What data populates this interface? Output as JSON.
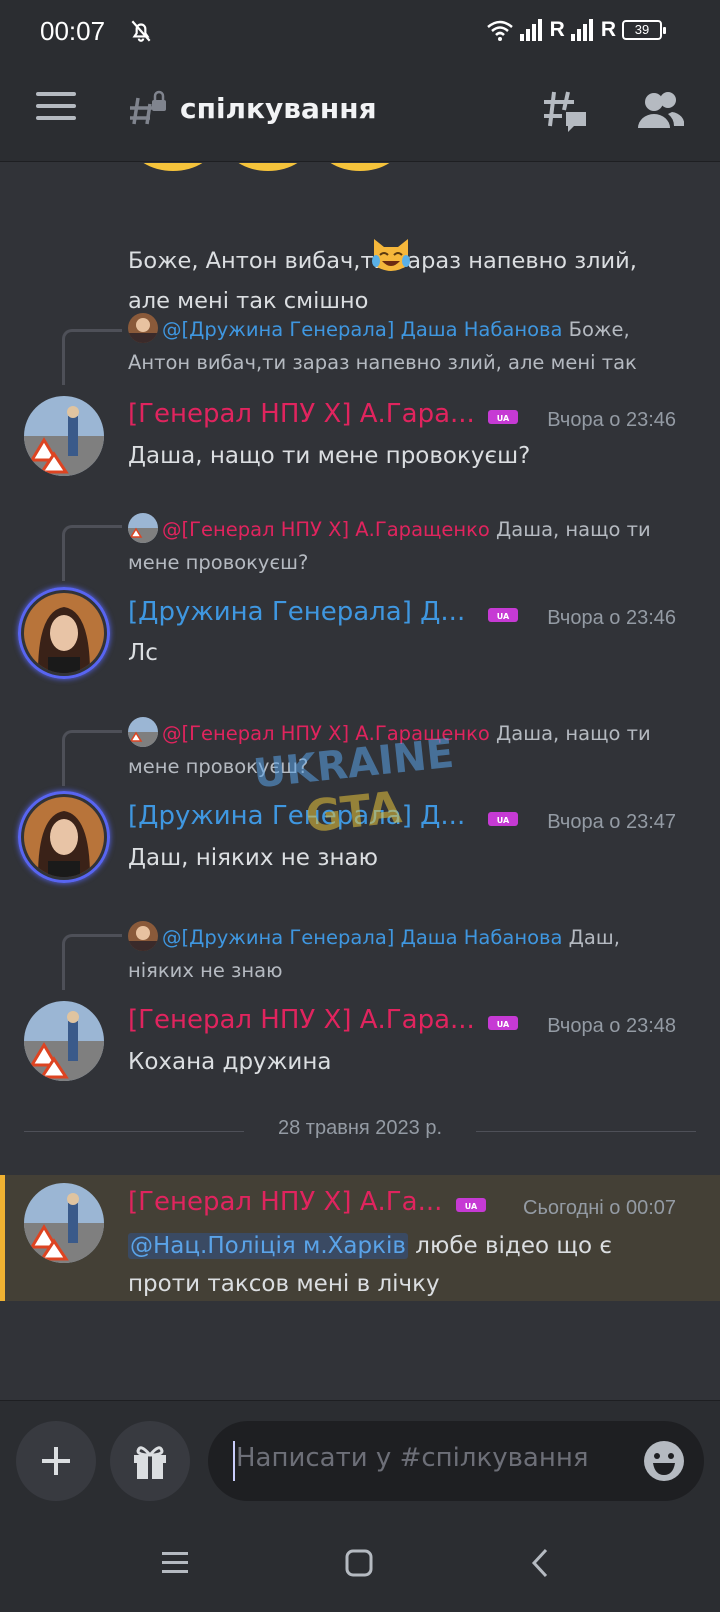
{
  "status_bar": {
    "time": "00:07",
    "signal_label_1": "R",
    "signal_label_2": "R",
    "battery": "39"
  },
  "header": {
    "channel_name": "спілкування",
    "icons": [
      "menu-icon",
      "locked-channel-icon",
      "threads-icon",
      "members-icon"
    ]
  },
  "messages": {
    "continued_text": "Боже, Антон вибач,ти зараз напевно злий,\nале мені так смішно",
    "m1": {
      "reply_mention": "@[Дружина Генерала] Даша Набанова",
      "reply_text": " Боже, Антон вибач,ти зараз напевно злий, але мені так",
      "author": "[Генерал НПУ X] А.Гара...",
      "time": "Вчора о 23:46",
      "text": "Даша, нащо ти мене провокуєш?"
    },
    "m2": {
      "reply_mention": "@[Генерал НПУ X] А.Гаращенко",
      "reply_text": " Даша, нащо ти мене провокуєш?",
      "author": "[Дружина Генерала] Д...",
      "time": "Вчора о 23:46",
      "text": "Лс"
    },
    "m3": {
      "reply_mention": "@[Генерал НПУ X] А.Гаращенко",
      "reply_text": " Даша, нащо ти мене провокуєш?",
      "author": "[Дружина Генерала] Д...",
      "time": "Вчора о 23:47",
      "text": "Даш, ніяких не знаю"
    },
    "m4": {
      "reply_mention": "@[Дружина Генерала] Даша Набанова",
      "reply_text": " Даш, ніяких не знаю",
      "author": "[Генерал НПУ X] А.Гара...",
      "time": "Вчора о 23:48",
      "text": "Кохана дружина"
    },
    "date_divider": "28 травня 2023 р.",
    "m5": {
      "author": "[Генерал НПУ X] А.Га...",
      "time": "Сьогодні о 00:07",
      "mention": "@Нац.Поліція м.Харків",
      "text_rest": " любе відео що є",
      "text_line2": "проти таксов мені в лічку"
    }
  },
  "composer": {
    "placeholder": "Написати у #спілкування",
    "icons": [
      "plus-icon",
      "gift-icon",
      "emoji-icon"
    ]
  },
  "colors": {
    "general_role": "#e0245e",
    "wife_role": "#3f97e0",
    "highlight_border": "#f0b232",
    "background": "#313338"
  }
}
